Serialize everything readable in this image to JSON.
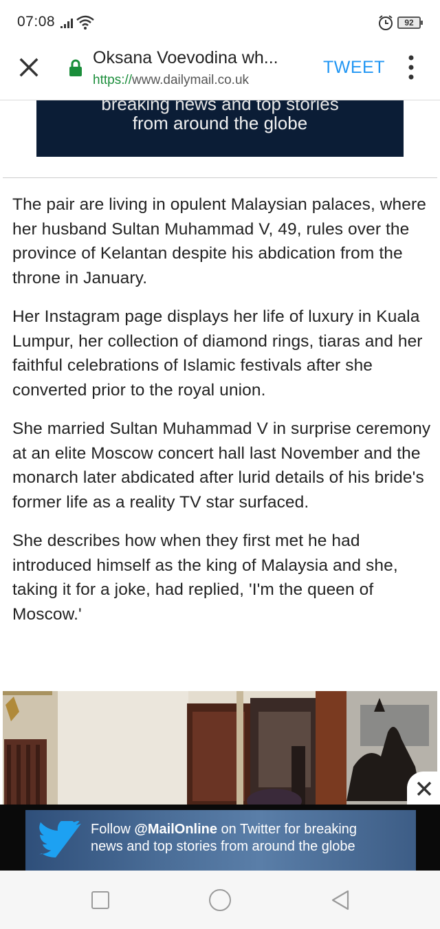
{
  "status_bar": {
    "time": "07:08",
    "battery_level": "92",
    "icons": [
      "signal-icon",
      "wifi-icon",
      "alarm-icon",
      "battery-icon"
    ]
  },
  "toolbar": {
    "title": "Oksana Voevodina wh...",
    "url_scheme": "https://",
    "url_host": "www.dailymail.co.uk",
    "tweet_label": "TWEET",
    "colors": {
      "secure": "#1a8d3a",
      "accent": "#2196f3"
    }
  },
  "top_banner": {
    "cut_text": "breaking news and top stories",
    "text": "from around the globe"
  },
  "article": {
    "paragraphs": [
      "The pair are living in opulent Malaysian palaces, where her husband Sultan Muhammad V, 49, rules over the province of Kelantan despite his abdication from the throne in January.",
      "Her Instagram page displays her life of luxury in Kuala Lumpur, her collection of diamond rings, tiaras and her faithful celebrations of Islamic festivals after she converted prior to the royal union.",
      "She married Sultan Muhammad V in surprise ceremony at an elite Moscow concert hall last November and the monarch later abdicated after lurid details of his bride's former life as a reality TV star surfaced.",
      "She describes how when they first met he had introduced himself as the king of Malaysia and she, taking it for a joke, had replied, 'I'm the queen of Moscow.'"
    ]
  },
  "bottom_ad": {
    "prefix": "Follow ",
    "handle": "@MailOnline",
    "suffix": " on Twitter for breaking",
    "line2": "news and top stories from around the globe"
  }
}
